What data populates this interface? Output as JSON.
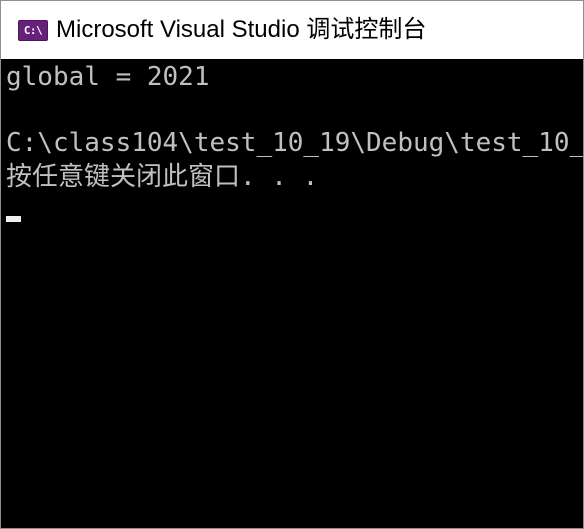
{
  "window": {
    "title": "Microsoft Visual Studio 调试控制台",
    "icon_label": "C:\\"
  },
  "console": {
    "lines": [
      "global = 2021",
      "C:\\class104\\test_10_19\\Debug\\test_10_",
      "按任意键关闭此窗口. . ."
    ]
  },
  "colors": {
    "console_background": "#000000",
    "console_text": "#c0c0c0",
    "titlebar_background": "#ffffff",
    "icon_background": "#68217a"
  }
}
